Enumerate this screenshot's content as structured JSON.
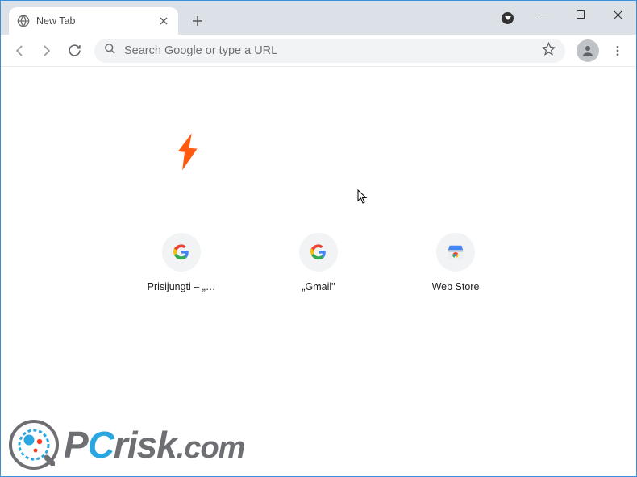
{
  "window": {
    "tab_title": "New Tab"
  },
  "omnibox": {
    "placeholder": "Search Google or type a URL",
    "value": ""
  },
  "shortcuts": [
    {
      "label": "Prisijungti – „…",
      "icon": "google"
    },
    {
      "label": "„Gmail\"",
      "icon": "google"
    },
    {
      "label": "Web Store",
      "icon": "webstore"
    }
  ],
  "watermark": {
    "text": "PCrisk.com"
  }
}
